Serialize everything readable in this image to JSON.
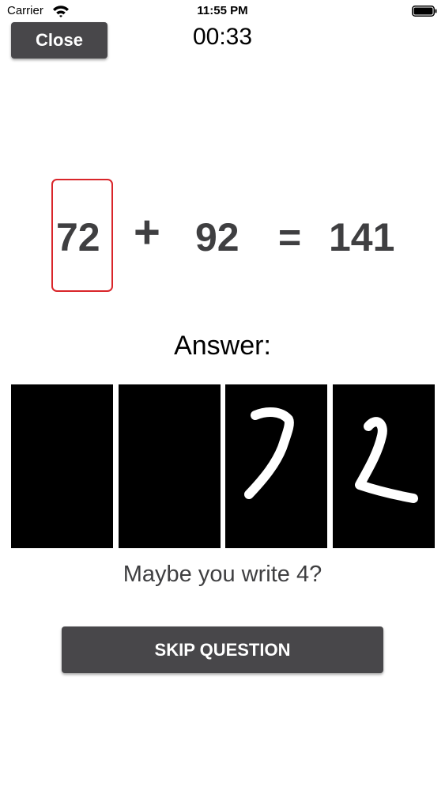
{
  "status_bar": {
    "carrier": "Carrier",
    "time": "11:55 PM",
    "icons": [
      "wifi-icon",
      "battery-icon"
    ]
  },
  "header": {
    "close_label": "Close",
    "timer": "00:33"
  },
  "equation": {
    "operand_1": "72",
    "operator": "+",
    "operand_2": "92",
    "equals": "=",
    "result": "141",
    "highlighted_operand": "operand_1",
    "highlight_color": "#d9252a"
  },
  "answer": {
    "label": "Answer:",
    "canvases": [
      {
        "strokes": "empty"
      },
      {
        "strokes": "empty"
      },
      {
        "strokes": "handwritten 7"
      },
      {
        "strokes": "handwritten 2"
      }
    ],
    "hint": "Maybe you write 4?"
  },
  "actions": {
    "skip_label": "SKIP QUESTION"
  },
  "colors": {
    "button_bg": "#48474a",
    "text_dark": "#3f3f41",
    "canvas_bg": "#000000",
    "stroke": "#ffffff"
  }
}
